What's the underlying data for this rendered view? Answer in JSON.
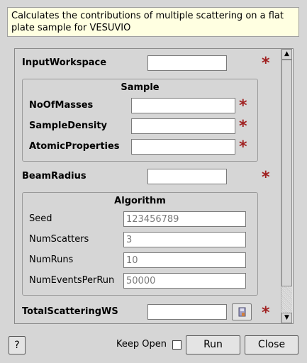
{
  "description": "Calculates the contributions of multiple scattering on a flat plate sample for VESUVIO",
  "fields": {
    "input_workspace": {
      "label": "InputWorkspace",
      "value": ""
    },
    "beam_radius": {
      "label": "BeamRadius",
      "value": ""
    },
    "total_scattering_ws": {
      "label": "TotalScatteringWS",
      "value": ""
    }
  },
  "sample_group": {
    "title": "Sample",
    "no_of_masses": {
      "label": "NoOfMasses",
      "value": ""
    },
    "sample_density": {
      "label": "SampleDensity",
      "value": ""
    },
    "atomic_properties": {
      "label": "AtomicProperties",
      "value": ""
    }
  },
  "algorithm_group": {
    "title": "Algorithm",
    "seed": {
      "label": "Seed",
      "placeholder": "123456789"
    },
    "num_scatters": {
      "label": "NumScatters",
      "placeholder": "3"
    },
    "num_runs": {
      "label": "NumRuns",
      "placeholder": "10"
    },
    "num_events_per_run": {
      "label": "NumEventsPerRun",
      "placeholder": "50000"
    }
  },
  "required_marker": "*",
  "scrollbar": {
    "position_fraction": 0.0
  },
  "footer": {
    "help_label": "?",
    "keep_open_label": "Keep Open",
    "keep_open_checked": false,
    "run_label": "Run",
    "close_label": "Close"
  },
  "colors": {
    "required_star": "#a02020",
    "description_bg": "#ffffe1",
    "window_bg": "#d6d6d6"
  }
}
